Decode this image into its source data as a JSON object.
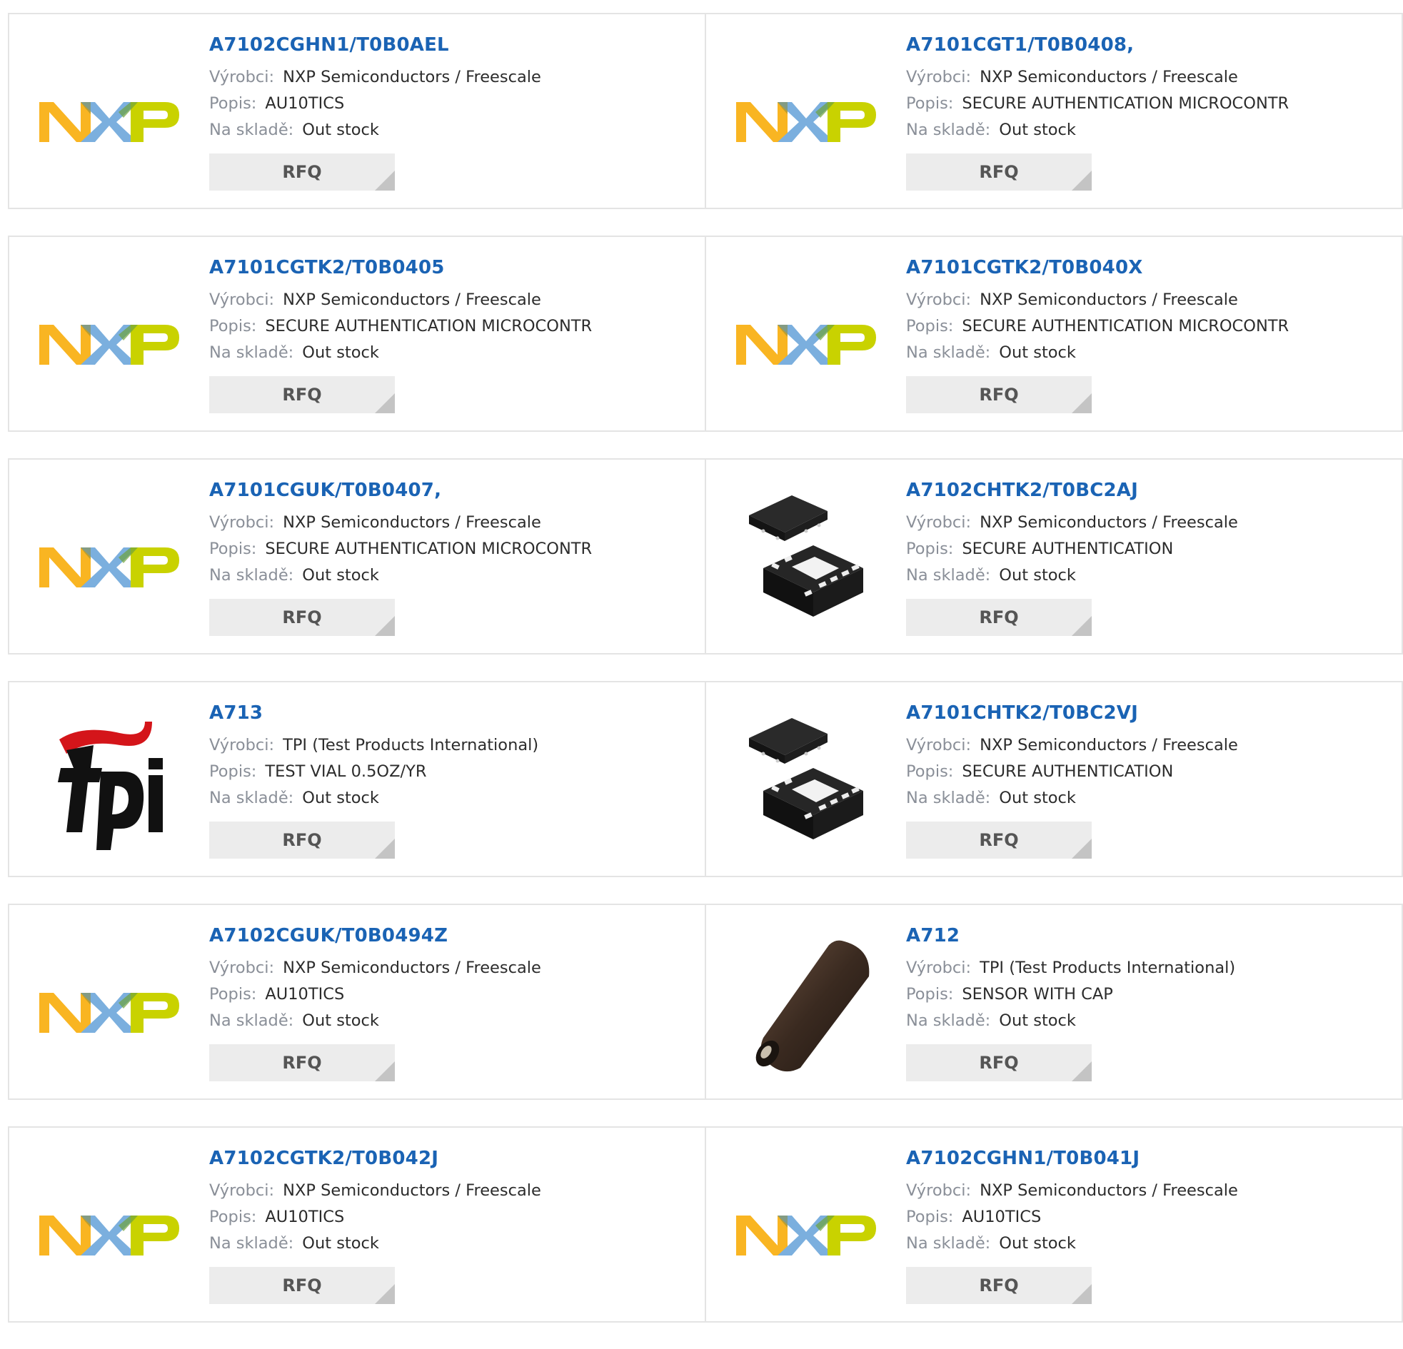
{
  "labels": {
    "manufacturer": "Výrobci:",
    "description": "Popis:",
    "stock": "Na skladě:",
    "rfq": "RFQ"
  },
  "products": [
    {
      "part": "A7102CGHN1/T0B0AEL",
      "manufacturer": "NXP Semiconductors / Freescale",
      "description": "AU10TICS",
      "stock": "Out stock",
      "image": "nxp-logo"
    },
    {
      "part": "A7101CGT1/T0B0408,",
      "manufacturer": "NXP Semiconductors / Freescale",
      "description": "SECURE AUTHENTICATION MICROCONTR",
      "stock": "Out stock",
      "image": "nxp-logo"
    },
    {
      "part": "A7101CGTK2/T0B0405",
      "manufacturer": "NXP Semiconductors / Freescale",
      "description": "SECURE AUTHENTICATION MICROCONTR",
      "stock": "Out stock",
      "image": "nxp-logo"
    },
    {
      "part": "A7101CGTK2/T0B040X",
      "manufacturer": "NXP Semiconductors / Freescale",
      "description": "SECURE AUTHENTICATION MICROCONTR",
      "stock": "Out stock",
      "image": "nxp-logo"
    },
    {
      "part": "A7101CGUK/T0B0407,",
      "manufacturer": "NXP Semiconductors / Freescale",
      "description": "SECURE AUTHENTICATION MICROCONTR",
      "stock": "Out stock",
      "image": "nxp-logo"
    },
    {
      "part": "A7102CHTK2/T0BC2AJ",
      "manufacturer": "NXP Semiconductors / Freescale",
      "description": "SECURE AUTHENTICATION",
      "stock": "Out stock",
      "image": "chip-package"
    },
    {
      "part": "A713",
      "manufacturer": "TPI (Test Products International)",
      "description": "TEST VIAL 0.5OZ/YR",
      "stock": "Out stock",
      "image": "tpi-logo"
    },
    {
      "part": "A7101CHTK2/T0BC2VJ",
      "manufacturer": "NXP Semiconductors / Freescale",
      "description": "SECURE AUTHENTICATION",
      "stock": "Out stock",
      "image": "chip-package"
    },
    {
      "part": "A7102CGUK/T0B0494Z",
      "manufacturer": "NXP Semiconductors / Freescale",
      "description": "AU10TICS",
      "stock": "Out stock",
      "image": "nxp-logo"
    },
    {
      "part": "A712",
      "manufacturer": "TPI (Test Products International)",
      "description": "SENSOR WITH CAP",
      "stock": "Out stock",
      "image": "sensor-cap"
    },
    {
      "part": "A7102CGTK2/T0B042J",
      "manufacturer": "NXP Semiconductors / Freescale",
      "description": "AU10TICS",
      "stock": "Out stock",
      "image": "nxp-logo"
    },
    {
      "part": "A7102CGHN1/T0B041J",
      "manufacturer": "NXP Semiconductors / Freescale",
      "description": "AU10TICS",
      "stock": "Out stock",
      "image": "nxp-logo"
    }
  ],
  "colors": {
    "link": "#1a63b4",
    "label": "#8a8f98",
    "value": "#2c2c2c",
    "button_bg": "#ececec",
    "border": "#e4e4e4",
    "nxp_n": "#f9b522",
    "nxp_x": "#7bafde",
    "nxp_p": "#c9d200",
    "tpi_red": "#d4151a"
  }
}
